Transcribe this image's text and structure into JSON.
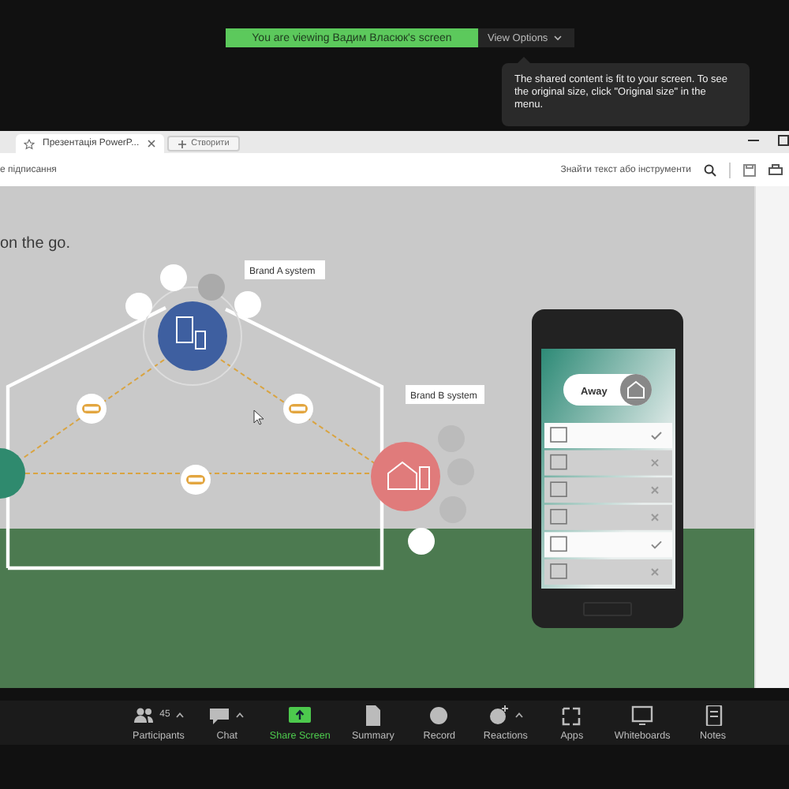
{
  "share_banner": {
    "text": "You are viewing Вадим Власюк's screen",
    "view_options": "View Options"
  },
  "tooltip": {
    "text": "The shared content is fit to your screen. To see the original size, click \"Original size\" in the menu."
  },
  "browser": {
    "tabs": [
      {
        "label": "Презентація PowerP...",
        "selected": true
      }
    ],
    "new_tab": "Створити",
    "toolbar_text": "е підписання",
    "search_placeholder": "Знайти текст або інструменти"
  },
  "slide": {
    "heading": "on the go.",
    "labels": [
      "Brand A system",
      "Brand B system"
    ],
    "phone": {
      "mode": "Away",
      "rows": [
        {
          "checked": true
        },
        {
          "checked": false
        },
        {
          "checked": false
        },
        {
          "checked": false
        },
        {
          "checked": true
        },
        {
          "checked": false
        }
      ]
    }
  },
  "toolbar": [
    {
      "kind": "participants",
      "label": "Participants",
      "count": "45",
      "caret": true,
      "accent": false
    },
    {
      "kind": "chat",
      "label": "Chat",
      "caret": true,
      "accent": false
    },
    {
      "kind": "share",
      "label": "Share Screen",
      "caret": false,
      "accent": true
    },
    {
      "kind": "summary",
      "label": "Summary",
      "caret": false,
      "accent": false
    },
    {
      "kind": "record",
      "label": "Record",
      "caret": false,
      "accent": false
    },
    {
      "kind": "reactions",
      "label": "Reactions",
      "caret": true,
      "accent": false
    },
    {
      "kind": "apps",
      "label": "Apps",
      "caret": false,
      "accent": false
    },
    {
      "kind": "whiteboards",
      "label": "Whiteboards",
      "caret": false,
      "accent": false
    },
    {
      "kind": "notes",
      "label": "Notes",
      "caret": false,
      "accent": false
    }
  ]
}
